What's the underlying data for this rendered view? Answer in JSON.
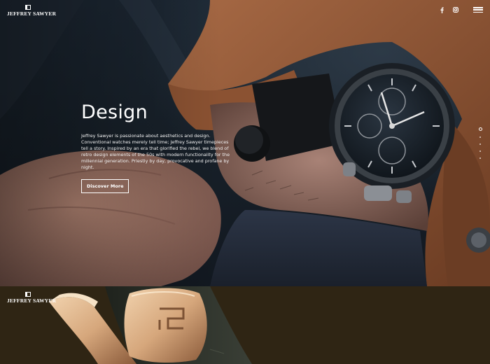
{
  "header": {
    "brand_name": "JEFFREY SAWYER",
    "icons": [
      "facebook-icon",
      "instagram-icon",
      "hamburger-menu-icon"
    ]
  },
  "hero": {
    "title": "Design",
    "text": "Jeffrey Sawyer is passionate about aesthetics and design. Conventional watches merely tell time; Jeffrey Sawyer timepieces tell a story. Inspired by an era that glorified the rebel, we blend of retro design elements of the 50s with modern functionality for the millennial generation. Priestly by day, provocative and profane by night.",
    "cta_label": "Discover More",
    "slides_total": 5,
    "active_slide": 1
  },
  "section2": {
    "brand_name": "JEFFREY SAWYER"
  },
  "colors": {
    "text": "#ffffff",
    "section_bg": "#2f2514",
    "leather": "#8a5433",
    "gold": "#d9b285"
  }
}
